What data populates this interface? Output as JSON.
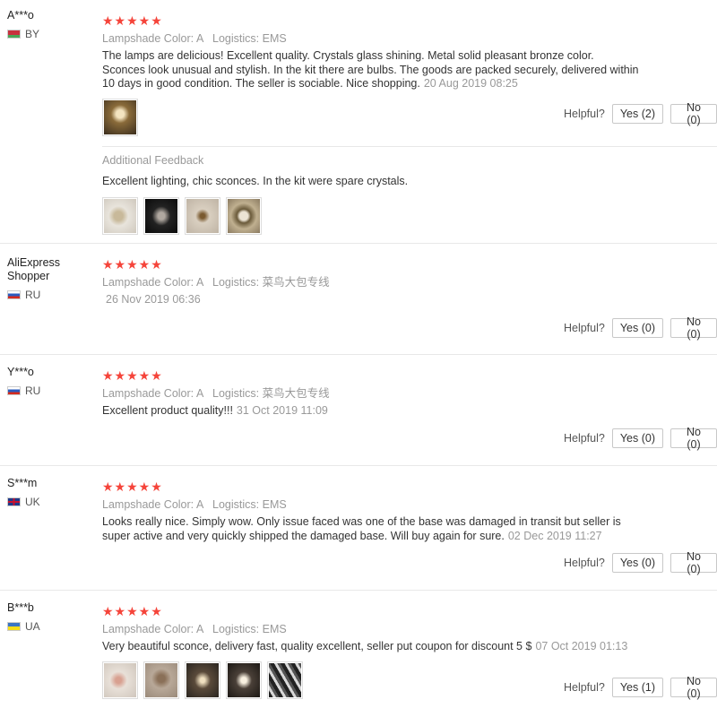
{
  "labels": {
    "lampshade": "Lampshade Color:",
    "logistics": "Logistics:",
    "helpful": "Helpful?",
    "additional": "Additional Feedback"
  },
  "reviews": [
    {
      "user": "A***o",
      "country": "BY",
      "stars": 5,
      "color": "A",
      "logistics": "EMS",
      "text": "The lamps are delicious! Excellent quality. Crystals glass shining. Metal solid pleasant bronze color. Sconces look unusual and stylish. In the kit there are bulbs. The goods are packed securely, delivered within 10 days in good condition. The seller is sociable. Nice shopping.",
      "date": "20 Aug 2019 08:25",
      "yes": "Yes (2)",
      "no": "No (0)",
      "additional_text": "Excellent lighting, chic sconces. In the kit were spare crystals."
    },
    {
      "user": "AliExpress Shopper",
      "country": "RU",
      "stars": 5,
      "color": "A",
      "logistics": "菜鸟大包专线",
      "text": "",
      "date": "26 Nov 2019 06:36",
      "yes": "Yes (0)",
      "no": "No (0)"
    },
    {
      "user": "Y***o",
      "country": "RU",
      "stars": 5,
      "color": "A",
      "logistics": "菜鸟大包专线",
      "text": "Excellent product quality!!!",
      "date": "31 Oct 2019 11:09",
      "yes": "Yes (0)",
      "no": "No (0)"
    },
    {
      "user": "S***m",
      "country": "UK",
      "stars": 5,
      "color": "A",
      "logistics": "EMS",
      "text": "Looks really nice. Simply wow. Only issue faced was one of the base was damaged in transit but seller is super active and very quickly shipped the damaged base. Will buy again for sure.",
      "date": "02 Dec 2019 11:27",
      "yes": "Yes (0)",
      "no": "No (0)"
    },
    {
      "user": "B***b",
      "country": "UA",
      "stars": 5,
      "color": "A",
      "logistics": "EMS",
      "text": "Very beautiful sconce, delivery fast, quality excellent, seller put coupon for discount 5 $",
      "date": "07 Oct 2019 01:13",
      "yes": "Yes (1)",
      "no": "No (0)"
    }
  ],
  "star_glyphs": "★★★★★",
  "colors": {
    "star": "#f5443a",
    "muted": "#999999",
    "border": "#e8e8e8"
  }
}
